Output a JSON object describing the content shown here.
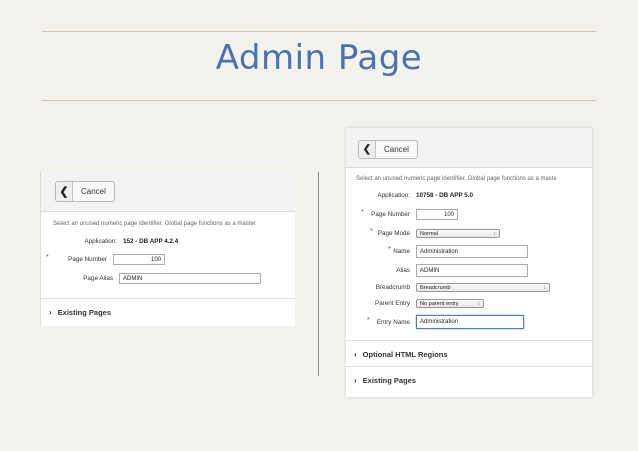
{
  "slide": {
    "title": "Admin Page"
  },
  "left_screenshot": {
    "cancel_label": "Cancel",
    "description": "Select an unused numeric page identifier. Global page functions as a master",
    "fields": {
      "application_label": "Application:",
      "application_value": "152 - DB APP 4.2.4",
      "required_mark": "*",
      "page_number_label": "Page Number",
      "page_number_value": "100",
      "page_alias_label": "Page Alias",
      "page_alias_value": "ADMIN"
    },
    "sections": {
      "existing_pages": "Existing Pages"
    }
  },
  "right_screenshot": {
    "cancel_label": "Cancel",
    "description": "Select an unused numeric page identifier. Global page functions as a maste",
    "fields": {
      "application_label": "Application:",
      "application_value": "10758 - DB APP 5.0",
      "required_mark": "*",
      "page_number_label": "Page Number",
      "page_number_value": "100",
      "page_mode_label": "Page Mode",
      "page_mode_value": "Normal",
      "name_label": "Name",
      "name_value": "Administration",
      "alias_label": "Alias",
      "alias_value": "ADMIN",
      "breadcrumb_label": "Breadcrumb",
      "breadcrumb_value": "Breadcrumb",
      "parent_entry_label": "Parent Entry",
      "parent_entry_value": "No parent entry",
      "entry_name_label": "Entry Name",
      "entry_name_value": "Administration"
    },
    "sections": {
      "optional_html_regions": "Optional HTML Regions",
      "existing_pages": "Existing Pages"
    }
  },
  "icons": {
    "back": "chevron-left-icon",
    "select_arrow": "up-down-arrows-icon",
    "section_toggle": "chevron-right-icon"
  }
}
